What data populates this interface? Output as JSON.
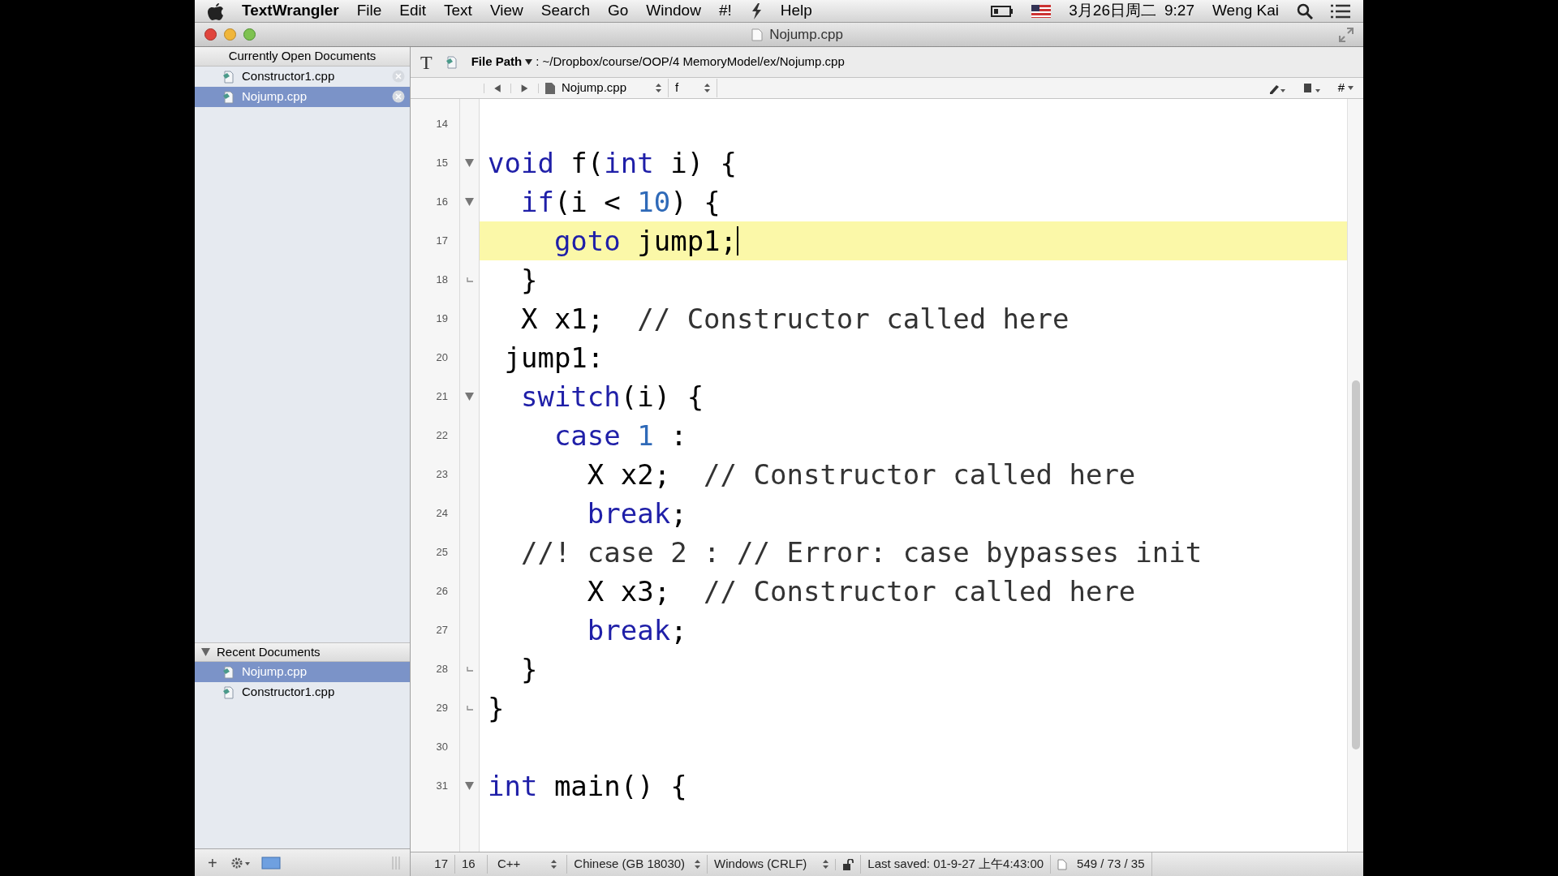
{
  "menu_bar": {
    "app": "TextWrangler",
    "items": [
      "File",
      "Edit",
      "Text",
      "View",
      "Search",
      "Go",
      "Window",
      "#!"
    ],
    "help": "Help",
    "date": "3月26日周二",
    "time": "9:27",
    "user": "Weng Kai"
  },
  "window": {
    "title": "Nojump.cpp"
  },
  "sidebar": {
    "open_header": "Currently Open Documents",
    "open_documents": [
      {
        "name": "Constructor1.cpp",
        "selected": false
      },
      {
        "name": "Nojump.cpp",
        "selected": true
      }
    ],
    "recent_header": "Recent Documents",
    "recent_expanded": true,
    "recent_documents": [
      {
        "name": "Nojump.cpp",
        "selected": true
      },
      {
        "name": "Constructor1.cpp",
        "selected": false
      }
    ],
    "add_label": "+"
  },
  "toolbar": {
    "text_tool": "T",
    "file_path_label": "File Path",
    "path": ": ~/Dropbox/course/OOP/4 MemoryModel/ex/Nojump.cpp",
    "right_menu": "#"
  },
  "nav_bar": {
    "file": "Nojump.cpp",
    "function": "f"
  },
  "editor": {
    "lines": [
      {
        "number": "14",
        "foldable": false,
        "fold_end": false,
        "current": false
      },
      {
        "number": "15",
        "foldable": true,
        "fold_end": false,
        "current": false,
        "tokens": [
          {
            "text": "void",
            "kind": "keyword"
          },
          {
            "text": " f(",
            "kind": "plain"
          },
          {
            "text": "int",
            "kind": "keyword"
          },
          {
            "text": " i) {",
            "kind": "plain"
          }
        ]
      },
      {
        "number": "16",
        "foldable": true,
        "fold_end": false,
        "current": false,
        "tokens": [
          {
            "text": "  if",
            "kind": "keyword"
          },
          {
            "text": "(i < ",
            "kind": "plain"
          },
          {
            "text": "10",
            "kind": "number"
          },
          {
            "text": ") {",
            "kind": "plain"
          }
        ]
      },
      {
        "number": "17",
        "foldable": false,
        "fold_end": false,
        "current": true,
        "tokens": [
          {
            "text": "    goto",
            "kind": "keyword"
          },
          {
            "text": " jump1;",
            "kind": "plain"
          }
        ]
      },
      {
        "number": "18",
        "foldable": false,
        "fold_end": true,
        "current": false,
        "tokens": [
          {
            "text": "  }",
            "kind": "plain"
          }
        ]
      },
      {
        "number": "19",
        "foldable": false,
        "fold_end": false,
        "current": false,
        "tokens": [
          {
            "text": "  X x1;  ",
            "kind": "plain"
          },
          {
            "text": "// Constructor called here",
            "kind": "comment"
          }
        ]
      },
      {
        "number": "20",
        "foldable": false,
        "fold_end": false,
        "current": false,
        "tokens": [
          {
            "text": " jump1:",
            "kind": "plain"
          }
        ]
      },
      {
        "number": "21",
        "foldable": true,
        "fold_end": false,
        "current": false,
        "tokens": [
          {
            "text": "  switch",
            "kind": "keyword"
          },
          {
            "text": "(i) {",
            "kind": "plain"
          }
        ]
      },
      {
        "number": "22",
        "foldable": false,
        "fold_end": false,
        "current": false,
        "tokens": [
          {
            "text": "    case",
            "kind": "keyword"
          },
          {
            "text": " 1",
            "kind": "number"
          },
          {
            "text": " :",
            "kind": "plain"
          }
        ]
      },
      {
        "number": "23",
        "foldable": false,
        "fold_end": false,
        "current": false,
        "tokens": [
          {
            "text": "      X x2;  ",
            "kind": "plain"
          },
          {
            "text": "// Constructor called here",
            "kind": "comment"
          }
        ]
      },
      {
        "number": "24",
        "foldable": false,
        "fold_end": false,
        "current": false,
        "tokens": [
          {
            "text": "      break",
            "kind": "keyword"
          },
          {
            "text": ";",
            "kind": "plain"
          }
        ]
      },
      {
        "number": "25",
        "foldable": false,
        "fold_end": false,
        "current": false,
        "tokens": [
          {
            "text": "  //! case 2 : // Error: case bypasses init",
            "kind": "comment"
          }
        ]
      },
      {
        "number": "26",
        "foldable": false,
        "fold_end": false,
        "current": false,
        "tokens": [
          {
            "text": "      X x3;  ",
            "kind": "plain"
          },
          {
            "text": "// Constructor called here",
            "kind": "comment"
          }
        ]
      },
      {
        "number": "27",
        "foldable": false,
        "fold_end": false,
        "current": false,
        "tokens": [
          {
            "text": "      break",
            "kind": "keyword"
          },
          {
            "text": ";",
            "kind": "plain"
          }
        ]
      },
      {
        "number": "28",
        "foldable": false,
        "fold_end": true,
        "current": false,
        "tokens": [
          {
            "text": "  }",
            "kind": "plain"
          }
        ]
      },
      {
        "number": "29",
        "foldable": false,
        "fold_end": true,
        "current": false,
        "tokens": [
          {
            "text": "}",
            "kind": "plain"
          }
        ]
      },
      {
        "number": "30",
        "foldable": false,
        "fold_end": false,
        "current": false
      },
      {
        "number": "31",
        "foldable": true,
        "fold_end": false,
        "current": false,
        "tokens": [
          {
            "text": "int",
            "kind": "keyword"
          },
          {
            "text": " main() {",
            "kind": "plain"
          }
        ]
      }
    ]
  },
  "status_bar": {
    "line": "17",
    "column": "16",
    "language": "C++",
    "encoding": "Chinese (GB 18030)",
    "line_endings": "Windows (CRLF)",
    "last_saved": "Last saved: 01-9-27 上午4:43:00",
    "counts": "549 / 73 / 35"
  }
}
